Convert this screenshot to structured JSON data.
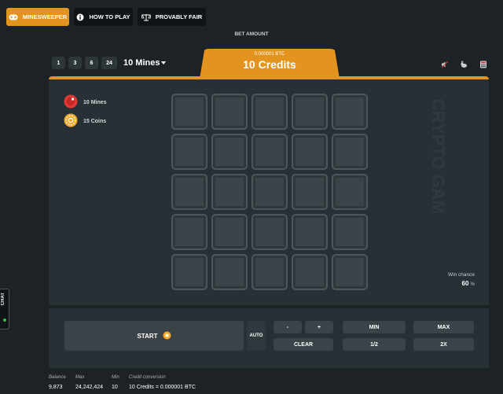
{
  "nav": {
    "items": [
      {
        "label": "MINESWEEPER",
        "icon": "gamepad-icon",
        "active": true
      },
      {
        "label": "HOW TO PLAY",
        "icon": "info-icon",
        "active": false
      },
      {
        "label": "PROVABLY FAIR",
        "icon": "scale-icon",
        "active": false
      }
    ]
  },
  "bet": {
    "header": "BET AMOUNT",
    "btc_amount": "0.000001 BTC",
    "credits": "10 Credits"
  },
  "mine_options": [
    "1",
    "3",
    "6",
    "24"
  ],
  "mines_selected": "10 Mines",
  "right_icons": [
    "sound-off-icon",
    "rabbit-icon",
    "calculator-icon"
  ],
  "legend": {
    "mines": "10 Mines",
    "coins": "15 Coins"
  },
  "watermark": "CRYPTO GAMES",
  "win_chance": {
    "label": "Win chance",
    "value": "60",
    "unit": "%"
  },
  "controls": {
    "start": "START",
    "auto": "AUTO",
    "minus": "-",
    "plus": "+",
    "min": "MIN",
    "max": "MAX",
    "clear": "CLEAR",
    "half": "1/2",
    "double": "2X"
  },
  "stats": {
    "balance_label": "Balance",
    "balance_value": "9,873",
    "max_label": "Max",
    "max_value": "24,242,424",
    "min_label": "Min",
    "min_value": "10",
    "conversion_label": "Credit conversion",
    "conversion_value": "10 Credits = 0.000001 BTC"
  },
  "chat": {
    "label": "CHAT"
  },
  "colors": {
    "accent": "#e2941e",
    "background": "#1c2225",
    "panel": "#273035",
    "tile": "#3b4448",
    "online": "#2fbf4a"
  }
}
